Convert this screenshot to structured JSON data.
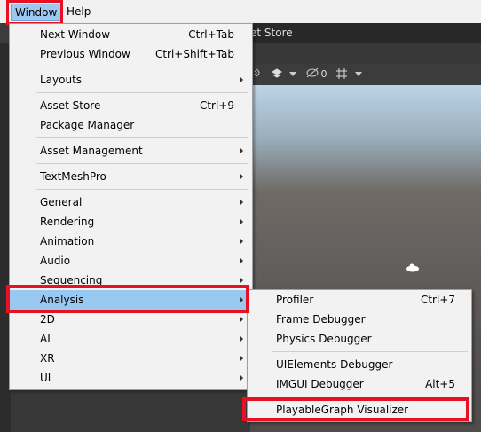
{
  "menubar": {
    "window_label": "Window",
    "help_label": "Help"
  },
  "editor": {
    "scene_tab_partial": "et Store",
    "toolbar_count": "0"
  },
  "window_menu": {
    "items": [
      {
        "label": "Next Window",
        "shortcut": "Ctrl+Tab"
      },
      {
        "label": "Previous Window",
        "shortcut": "Ctrl+Shift+Tab"
      },
      {
        "label": "Layouts",
        "submenu": true
      },
      {
        "label": "Asset Store",
        "shortcut": "Ctrl+9"
      },
      {
        "label": "Package Manager"
      },
      {
        "label": "Asset Management",
        "submenu": true
      },
      {
        "label": "TextMeshPro",
        "submenu": true
      },
      {
        "label": "General",
        "submenu": true
      },
      {
        "label": "Rendering",
        "submenu": true
      },
      {
        "label": "Animation",
        "submenu": true
      },
      {
        "label": "Audio",
        "submenu": true
      },
      {
        "label": "Sequencing",
        "submenu": true
      },
      {
        "label": "Analysis",
        "submenu": true,
        "highlighted": true
      },
      {
        "label": "2D",
        "submenu": true
      },
      {
        "label": "AI",
        "submenu": true
      },
      {
        "label": "XR",
        "submenu": true
      },
      {
        "label": "UI",
        "submenu": true
      }
    ]
  },
  "analysis_submenu": {
    "items": [
      {
        "label": "Profiler",
        "shortcut": "Ctrl+7"
      },
      {
        "label": "Frame Debugger"
      },
      {
        "label": "Physics Debugger"
      },
      {
        "label": "UIElements Debugger"
      },
      {
        "label": "IMGUI Debugger",
        "shortcut": "Alt+5"
      },
      {
        "label": "PlayableGraph Visualizer",
        "highlighted_box": true
      }
    ]
  },
  "colors": {
    "highlight": "#99c8f0",
    "annotation_red": "#e81123"
  }
}
